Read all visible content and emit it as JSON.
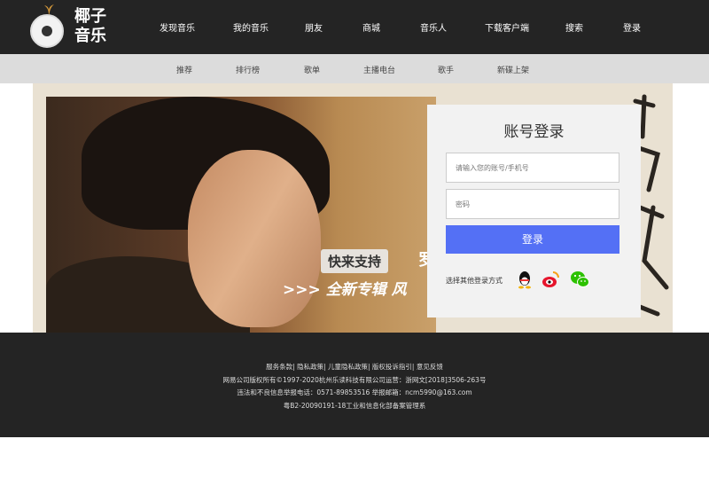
{
  "header": {
    "logo_text": [
      "椰子",
      "音乐"
    ],
    "nav": [
      "发现音乐",
      "我的音乐",
      "朋友",
      "商城",
      "音乐人",
      "下载客户端",
      "搜索",
      "登录"
    ]
  },
  "subnav": [
    "推荐",
    "排行榜",
    "歌单",
    "主播电台",
    "歌手",
    "新碟上架"
  ],
  "banner": {
    "promo_line1": "快来支持",
    "promo_line1_suffix": "罗",
    "promo_line2": ">>> 全新专辑  风"
  },
  "login": {
    "title": "账号登录",
    "account_placeholder": "请输入您的账号/手机号",
    "password_placeholder": "密码",
    "submit_label": "登录",
    "other_methods_label": "选择其他登录方式",
    "social": [
      "qq-icon",
      "weibo-icon",
      "wechat-icon"
    ]
  },
  "footer": {
    "lines": [
      "服务条款| 隐私政策| 儿童隐私政策| 版权投诉指引| 意见反馈",
      "网易公司版权所有©1997-2020杭州乐读科技有限公司运营：浙网文[2018]3506-263号",
      "违法和不良信息举报电话：0571-89853516 举报邮箱：ncm5990@163.com",
      "粤B2-20090191-18工业和信息化部备案管理系"
    ]
  },
  "colors": {
    "header_bg": "#242424",
    "subnav_bg": "#dcdcdc",
    "login_button": "#5470f5",
    "login_panel": "#f2f2f2"
  }
}
